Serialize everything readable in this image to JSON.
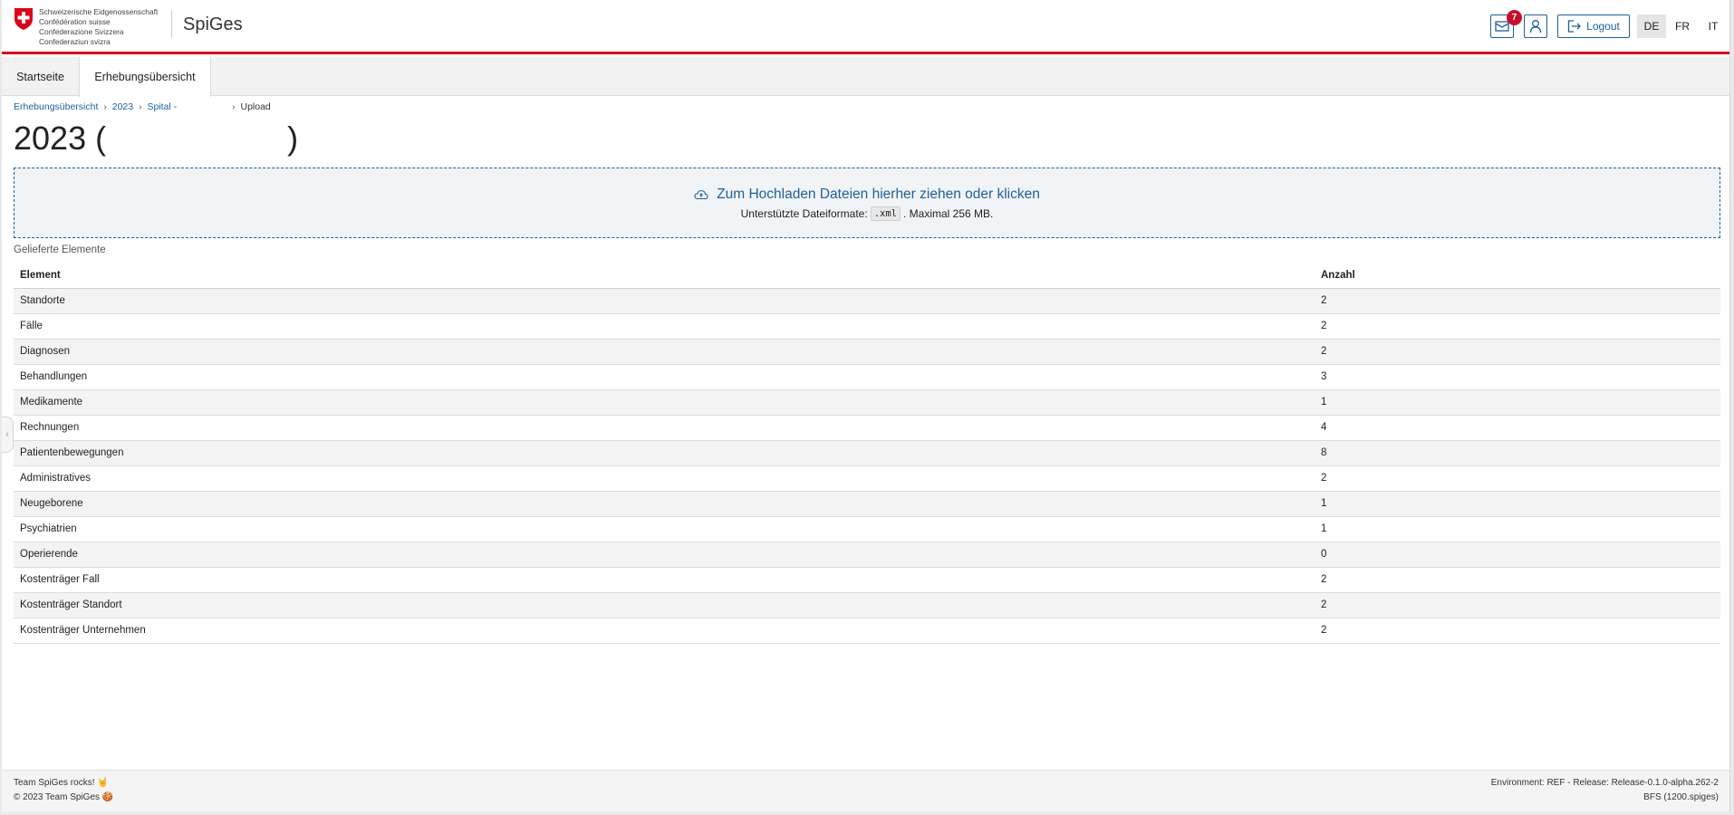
{
  "header": {
    "confederation_lines": [
      "Schweizerische Eidgenossenschaft",
      "Confédération suisse",
      "Confederazione Svizzera",
      "Confederaziun svizra"
    ],
    "app_title": "SpiGes",
    "mail_badge": "7",
    "logout_label": "Logout",
    "languages": [
      "DE",
      "FR",
      "IT"
    ],
    "active_language": "DE"
  },
  "tabs": [
    {
      "label": "Startseite",
      "active": false
    },
    {
      "label": "Erhebungsübersicht",
      "active": true
    }
  ],
  "breadcrumb": {
    "items": [
      "Erhebungsübersicht",
      "2023",
      "Spital -"
    ],
    "current": "Upload"
  },
  "page": {
    "title": "2023 (                    )"
  },
  "dropzone": {
    "main_text": "Zum Hochladen Dateien hierher ziehen oder klicken",
    "sub_prefix": "Unterstützte Dateiformate:",
    "format": ".xml",
    "sub_suffix": ". Maximal 256 MB."
  },
  "table": {
    "caption": "Gelieferte Elemente",
    "headers": [
      "Element",
      "Anzahl"
    ],
    "rows": [
      [
        "Standorte",
        "2"
      ],
      [
        "Fälle",
        "2"
      ],
      [
        "Diagnosen",
        "2"
      ],
      [
        "Behandlungen",
        "3"
      ],
      [
        "Medikamente",
        "1"
      ],
      [
        "Rechnungen",
        "4"
      ],
      [
        "Patientenbewegungen",
        "8"
      ],
      [
        "Administratives",
        "2"
      ],
      [
        "Neugeborene",
        "1"
      ],
      [
        "Psychiatrien",
        "1"
      ],
      [
        "Operierende",
        "0"
      ],
      [
        "Kostenträger Fall",
        "2"
      ],
      [
        "Kostenträger Standort",
        "2"
      ],
      [
        "Kostenträger Unternehmen",
        "2"
      ]
    ]
  },
  "footer": {
    "left_line1": "Team SpiGes rocks! 🤘",
    "left_line2": "© 2023 Team SpiGes 🍪",
    "right_line1": "Environment: REF - Release: Release-0.1.0-alpha.262-2",
    "right_line2": "BFS (1200.spiges)"
  },
  "colors": {
    "accent_blue": "#1f5f99",
    "swiss_red": "#dc0018",
    "badge_red": "#c8102e"
  }
}
